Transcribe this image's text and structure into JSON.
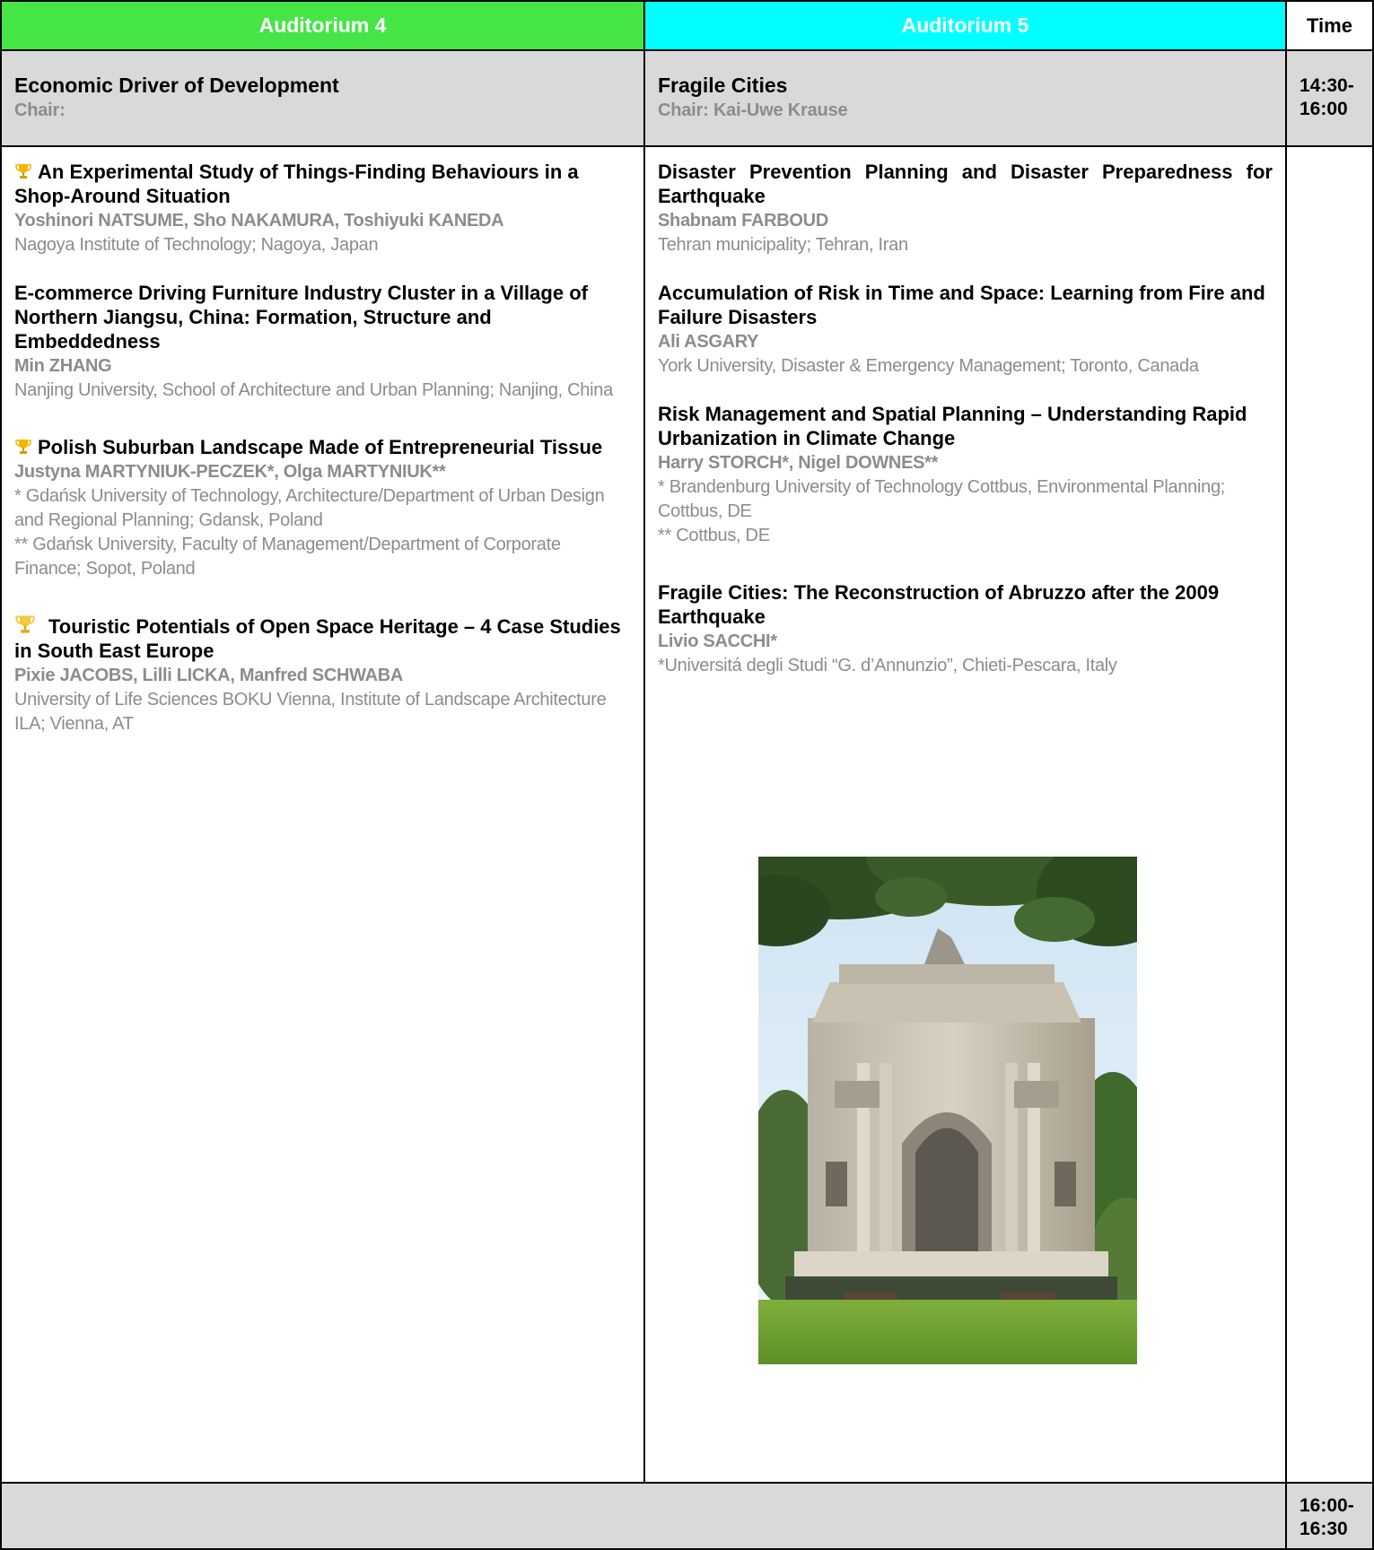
{
  "header": {
    "auditorium4": "Auditorium 4",
    "auditorium5": "Auditorium 5",
    "time": "Time"
  },
  "colors": {
    "auditorium4_header": "#46e546",
    "auditorium5_header": "#00ffff",
    "session_bg": "#d9d9d9",
    "trophy": "#f2b705"
  },
  "sessions": {
    "a4": {
      "title": "Economic Driver of Development",
      "chair": "Chair:"
    },
    "a5": {
      "title": "Fragile Cities",
      "chair": "Chair: Kai-Uwe Krause"
    },
    "time": "14:30-16:00"
  },
  "time_labels": {
    "slot1_line1": "14:30-",
    "slot1_line2": "16:00",
    "slot2_line1": "16:00-",
    "slot2_line2": "16:30"
  },
  "papers_a4": [
    {
      "award_icon": "trophy-icon",
      "title": "An Experimental Study of Things-Finding Behaviours in a Shop-Around Situation",
      "authors": "Yoshinori NATSUME, Sho NAKAMURA, Toshiyuki KANEDA",
      "affiliation1": "Nagoya Institute of Technology; Nagoya, Japan"
    },
    {
      "title": "E-commerce Driving Furniture Industry Cluster in a Village of Northern Jiangsu, China: Formation, Structure and Embeddedness",
      "authors": "Min ZHANG",
      "affiliation1": "Nanjing University, School of Architecture and Urban Planning; Nanjing, China"
    },
    {
      "award_icon": "trophy-icon",
      "title": "Polish Suburban Landscape Made of Entrepreneurial Tissue",
      "authors": "Justyna MARTYNIUK-PECZEK*, Olga MARTYNIUK**",
      "affiliation1": "* Gdańsk University of Technology, Architecture/Department of Urban Design and Regional Planning; Gdansk, Poland",
      "affiliation2": "** Gdańsk University, Faculty of Management/Department of Corporate Finance; Sopot, Poland"
    },
    {
      "award_icon": "trophy-icon",
      "title": "Touristic Potentials of Open Space Heritage – 4 Case Studies in South East Europe",
      "authors": "Pixie JACOBS, Lilli LICKA, Manfred SCHWABA",
      "affiliation1": "University of Life Sciences BOKU Vienna, Institute of Landscape Architecture ILA; Vienna, AT"
    }
  ],
  "papers_a5": [
    {
      "title": "Disaster Prevention Planning and Disaster Preparedness for Earthquake",
      "authors": "Shabnam FARBOUD",
      "affiliation1": "Tehran municipality; Tehran, Iran"
    },
    {
      "title": "Accumulation of Risk in Time and Space: Learning from Fire and Failure Disasters",
      "authors": "Ali ASGARY",
      "affiliation1": "York University, Disaster & Emergency Management; Toronto, Canada"
    },
    {
      "title": "Risk Management and Spatial Planning – Understanding Rapid Urbanization in Climate Change",
      "authors": "Harry STORCH*, Nigel DOWNES**",
      "affiliation1": "* Brandenburg University of Technology Cottbus, Environmental Planning; Cottbus, DE",
      "affiliation2": "** Cottbus, DE"
    },
    {
      "title": "Fragile Cities: The Reconstruction of Abruzzo after the 2009 Earthquake",
      "authors": "Livio SACCHI*",
      "affiliation1": "*Universitá degli Studi “G. d’Annunzio”, Chieti-Pescara, Italy"
    }
  ]
}
